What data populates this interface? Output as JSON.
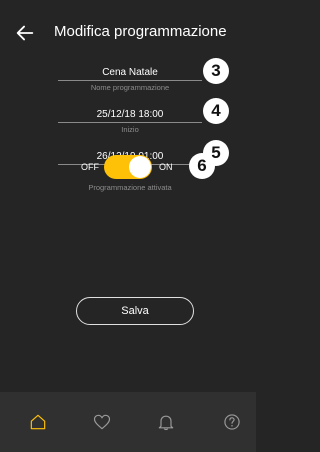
{
  "header": {
    "title": "Modifica programmazione",
    "back_icon": "arrow-left-icon"
  },
  "fields": [
    {
      "value": "Cena Natale",
      "label": "Nome programmazione",
      "badge": "3"
    },
    {
      "value": "25/12/18 18:00",
      "label": "Inizio",
      "badge": "4"
    },
    {
      "value": "26/12/19 01:00",
      "label": "Fine",
      "badge": "5"
    }
  ],
  "toggle": {
    "off_label": "OFF",
    "on_label": "ON",
    "state": "on",
    "caption": "Programmazione attivata",
    "badge": "6",
    "color": "#ffc107"
  },
  "save_button": {
    "label": "Salva"
  },
  "bottom_nav": [
    {
      "icon": "home-icon",
      "active": true,
      "color": "#ffc107"
    },
    {
      "icon": "heart-icon",
      "active": false
    },
    {
      "icon": "bell-icon",
      "active": false
    },
    {
      "icon": "help-icon",
      "active": false
    }
  ]
}
